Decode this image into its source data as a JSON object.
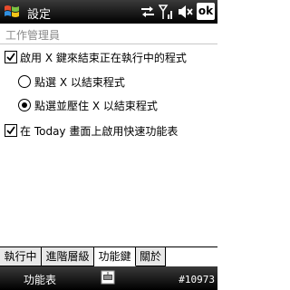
{
  "titlebar": {
    "title": "設定",
    "ok_label": "ok"
  },
  "header": {
    "title": "工作管理員"
  },
  "options": {
    "enable_x_close": {
      "label": "啟用 X 鍵來結束正在執行中的程式",
      "checked": true
    },
    "tap_x": {
      "label": "點選 X 以結束程式",
      "selected": false
    },
    "tap_hold_x": {
      "label": "點選並壓住 X 以結束程式",
      "selected": true
    },
    "today_shortcut": {
      "label": "在 Today 畫面上啟用快速功能表",
      "checked": true
    }
  },
  "tabs": [
    {
      "label": "執行中",
      "active": false
    },
    {
      "label": "進階層級",
      "active": false
    },
    {
      "label": "功能鍵",
      "active": true
    },
    {
      "label": "關於",
      "active": false
    }
  ],
  "menubar": {
    "left_softkey": "功能表",
    "watermark": "#10973"
  },
  "icons": {
    "start": "windows-flag-icon",
    "sync": "sync-arrows-icon",
    "signal": "signal-strength-icon",
    "volume": "volume-muted-icon",
    "keyboard": "keyboard-icon"
  }
}
